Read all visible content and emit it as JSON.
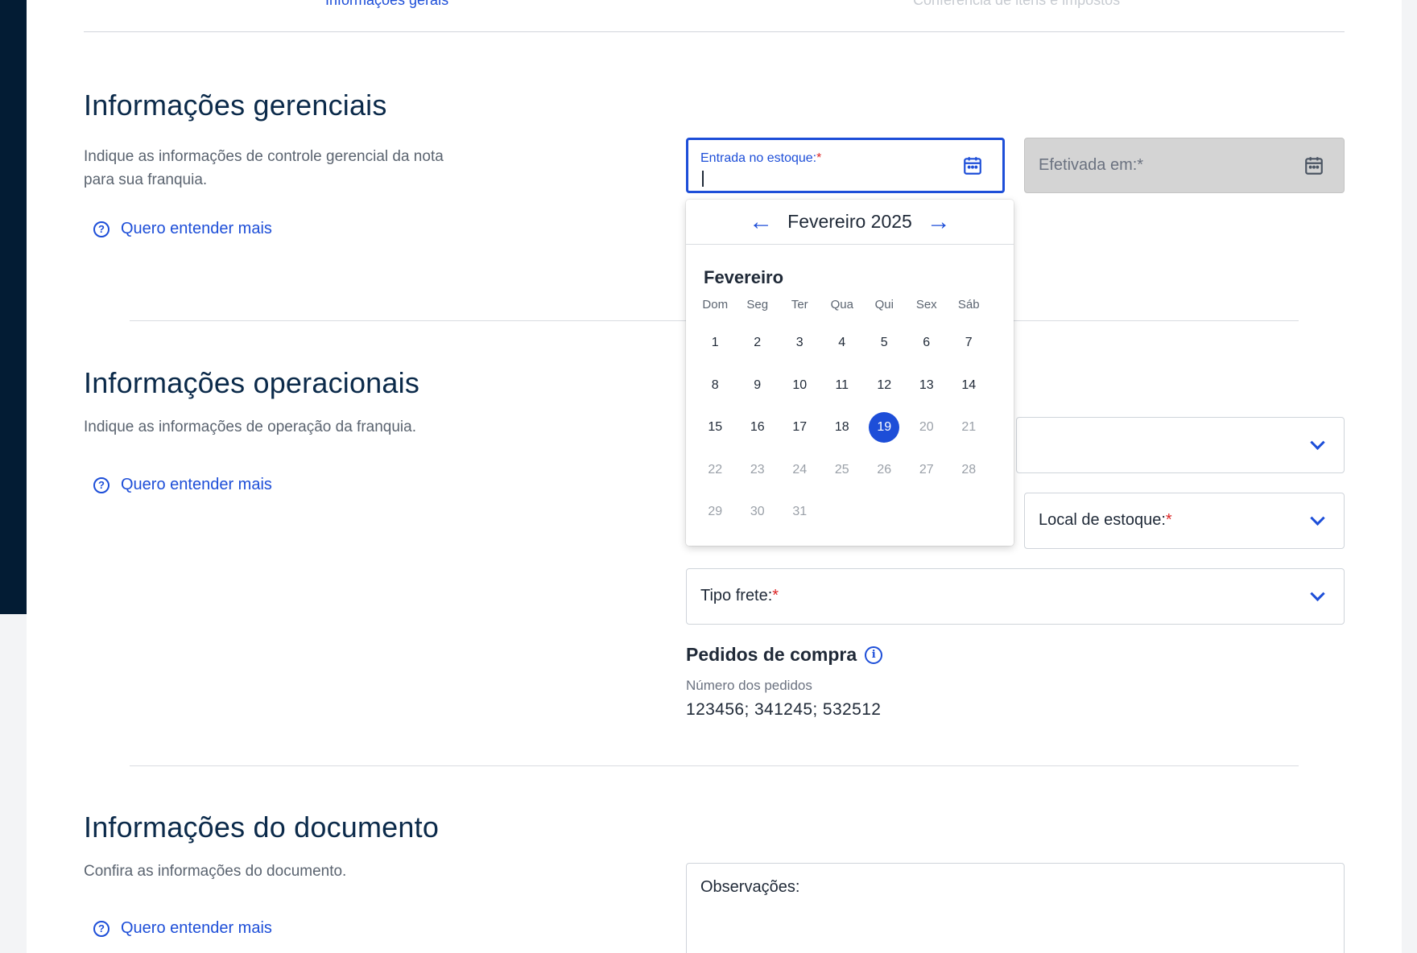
{
  "tabs": [
    {
      "label": "Informações gerais",
      "active": true
    },
    {
      "label": "Conferência de itens e impostos",
      "active": false
    }
  ],
  "sections": {
    "gerenciais": {
      "title": "Informações gerenciais",
      "description": "Indique as informações de controle gerencial da nota para sua franquia.",
      "help": "Quero entender mais"
    },
    "operacionais": {
      "title": "Informações operacionais",
      "description": "Indique as informações de operação da franquia.",
      "help": "Quero entender mais"
    },
    "documento": {
      "title": "Informações do documento",
      "description": "Confira as informações do documento.",
      "help": "Quero entender mais"
    }
  },
  "fields": {
    "entrada": {
      "label": "Entrada no estoque:",
      "required": "*",
      "value": ""
    },
    "efetivada": {
      "label": "Efetivada em:*"
    },
    "local_estoque": {
      "label": "Local de estoque:",
      "required": "*"
    },
    "tipo_frete": {
      "label": "Tipo frete:",
      "required": "*"
    },
    "observacoes": {
      "label": "Observações:"
    }
  },
  "pedidos": {
    "title": "Pedidos de compra",
    "label": "Número dos pedidos",
    "value": "123456; 341245; 532512"
  },
  "datepicker": {
    "header": "Fevereiro 2025",
    "prev": "←",
    "next": "→",
    "month_label": "Fevereiro",
    "weekdays": [
      "Dom",
      "Seg",
      "Ter",
      "Qua",
      "Qui",
      "Sex",
      "Sáb"
    ],
    "days": [
      "1",
      "2",
      "3",
      "4",
      "5",
      "6",
      "7",
      "8",
      "9",
      "10",
      "11",
      "12",
      "13",
      "14",
      "15",
      "16",
      "17",
      "18",
      "19",
      "20",
      "21",
      "22",
      "23",
      "24",
      "25",
      "26",
      "27",
      "28",
      "29",
      "30",
      "31"
    ],
    "selected_day": "19"
  },
  "colors": {
    "accent": "#1d4ed8",
    "sidebar": "#031c34",
    "required": "#dc2626"
  }
}
